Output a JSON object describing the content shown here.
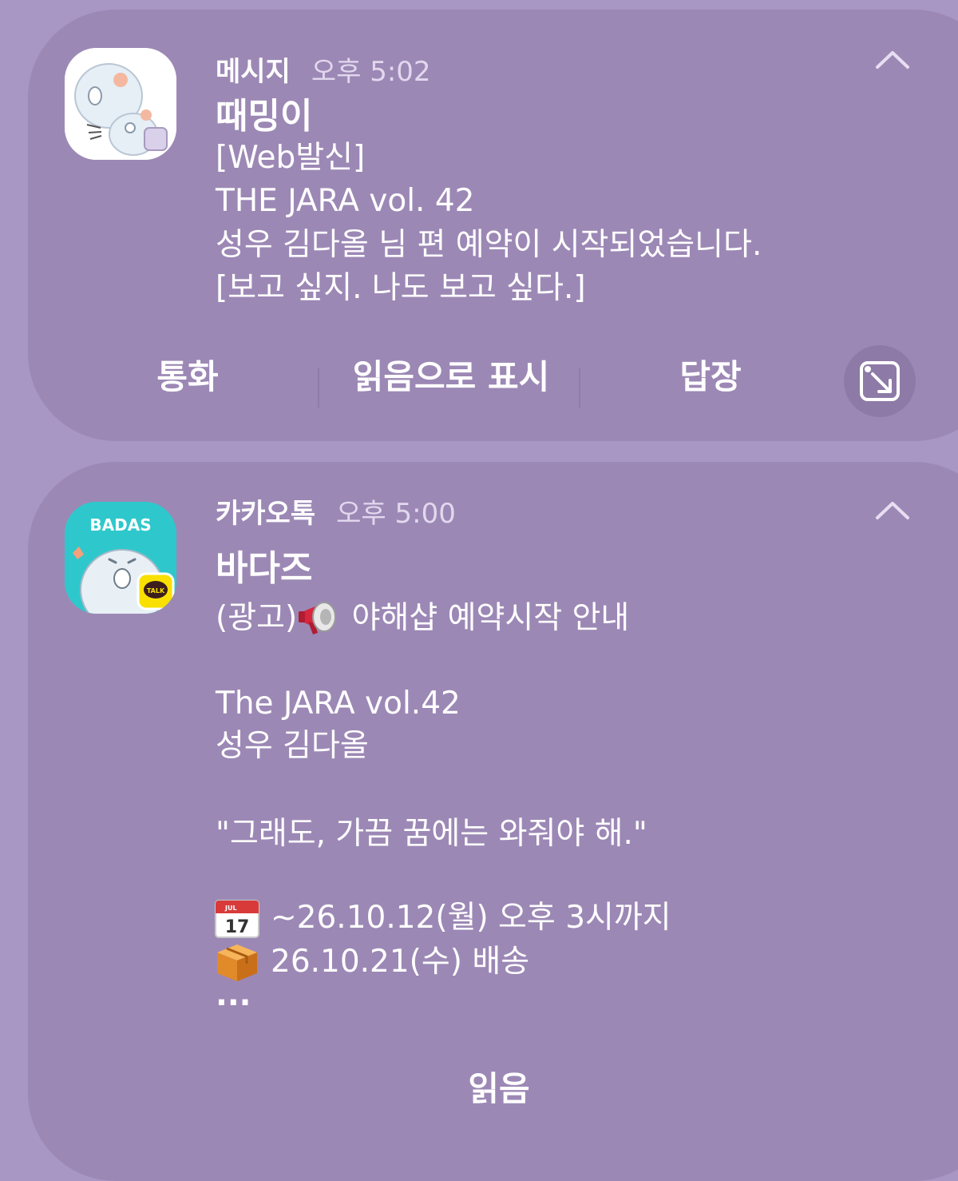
{
  "notifications": [
    {
      "app_name": "메시지",
      "time": "오후 5:02",
      "sender": "때밍이",
      "message_lines": [
        "[Web발신]",
        "THE JARA vol. 42",
        "성우 김다올 님 편 예약이 시작되었습니다.",
        "[보고 싶지. 나도 보고 싶다.]"
      ],
      "actions": [
        "통화",
        "읽음으로 표시",
        "답장"
      ],
      "icon": "sticker-avatar-icon"
    },
    {
      "app_name": "카카오톡",
      "time": "오후 5:00",
      "sender": "바다즈",
      "icon_label": "BADAS",
      "talk_badge": "TALK",
      "ad_line": "(광고)",
      "ad_line_rest": " 야해샵 예약시작 안내",
      "message_lines": [
        "The JARA vol.42",
        "성우 김다올",
        "\"그래도, 가끔 꿈에는 와줘야 해.\""
      ],
      "calendar_emoji_text": "17",
      "calendar_month": "JUL",
      "date_line_1": "~26.10.12(월) 오후 3시까지",
      "date_line_2": "26.10.21(수) 배송",
      "ellipsis": "...",
      "action": "읽음"
    }
  ],
  "colors": {
    "background": "#a896c4",
    "card": "#9c88b5",
    "kakao_teal": "#2ec8cc",
    "kakao_yellow": "#f9e000"
  }
}
